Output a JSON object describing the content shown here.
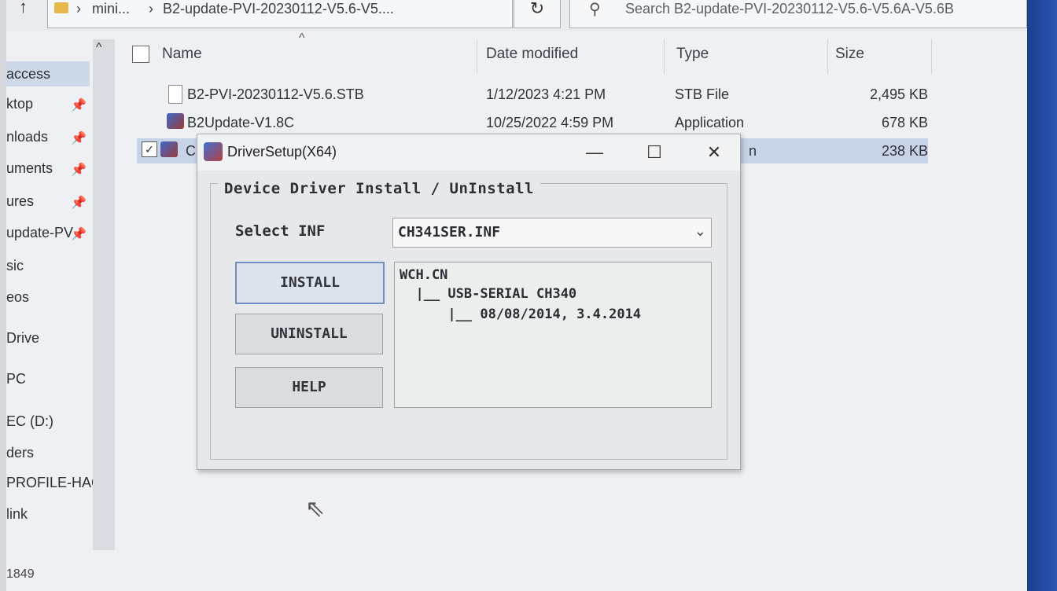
{
  "explorer": {
    "breadcrumb": [
      "mini...",
      "B2-update-PVI-20230112-V5.6-V5...."
    ],
    "search_placeholder": "Search B2-update-PVI-20230112-V5.6-V5.6A-V5.6B",
    "nav_items": [
      {
        "label": "access",
        "pinned": false,
        "selected": true
      },
      {
        "label": "ktop",
        "pinned": true
      },
      {
        "label": "nloads",
        "pinned": true
      },
      {
        "label": "uments",
        "pinned": true
      },
      {
        "label": "ures",
        "pinned": true
      },
      {
        "label": "update-PV",
        "pinned": true
      },
      {
        "label": "sic",
        "pinned": false
      },
      {
        "label": "eos",
        "pinned": false
      },
      {
        "label": "Drive",
        "pinned": false
      },
      {
        "label": "PC",
        "pinned": false
      },
      {
        "label": "EC (D:)",
        "pinned": false
      },
      {
        "label": "ders",
        "pinned": false
      },
      {
        "label": "PROFILE-HAC",
        "pinned": false
      },
      {
        "label": "link",
        "pinned": false
      }
    ],
    "status_count": "1849",
    "columns": {
      "name": "Name",
      "date": "Date modified",
      "type": "Type",
      "size": "Size"
    },
    "files": [
      {
        "name": "B2-PVI-20230112-V5.6.STB",
        "date": "1/12/2023 4:21 PM",
        "type": "STB File",
        "size": "2,495 KB",
        "icon": "file-icon"
      },
      {
        "name": "B2Update-V1.8C",
        "date": "10/25/2022 4:59 PM",
        "type": "Application",
        "size": "678 KB",
        "icon": "app-icon"
      },
      {
        "name": "C",
        "date": "",
        "type": "n",
        "size": "238 KB",
        "icon": "app-icon",
        "selected": true
      }
    ]
  },
  "dialog": {
    "title": "DriverSetup(X64)",
    "group_label": "Device Driver Install / UnInstall",
    "select_label": "Select INF",
    "inf_value": "CH341SER.INF",
    "buttons": {
      "install": "INSTALL",
      "uninstall": "UNINSTALL",
      "help": "HELP"
    },
    "info_lines": [
      "WCH.CN",
      "  |__ USB-SERIAL CH340",
      "      |__ 08/08/2014, 3.4.2014"
    ]
  }
}
